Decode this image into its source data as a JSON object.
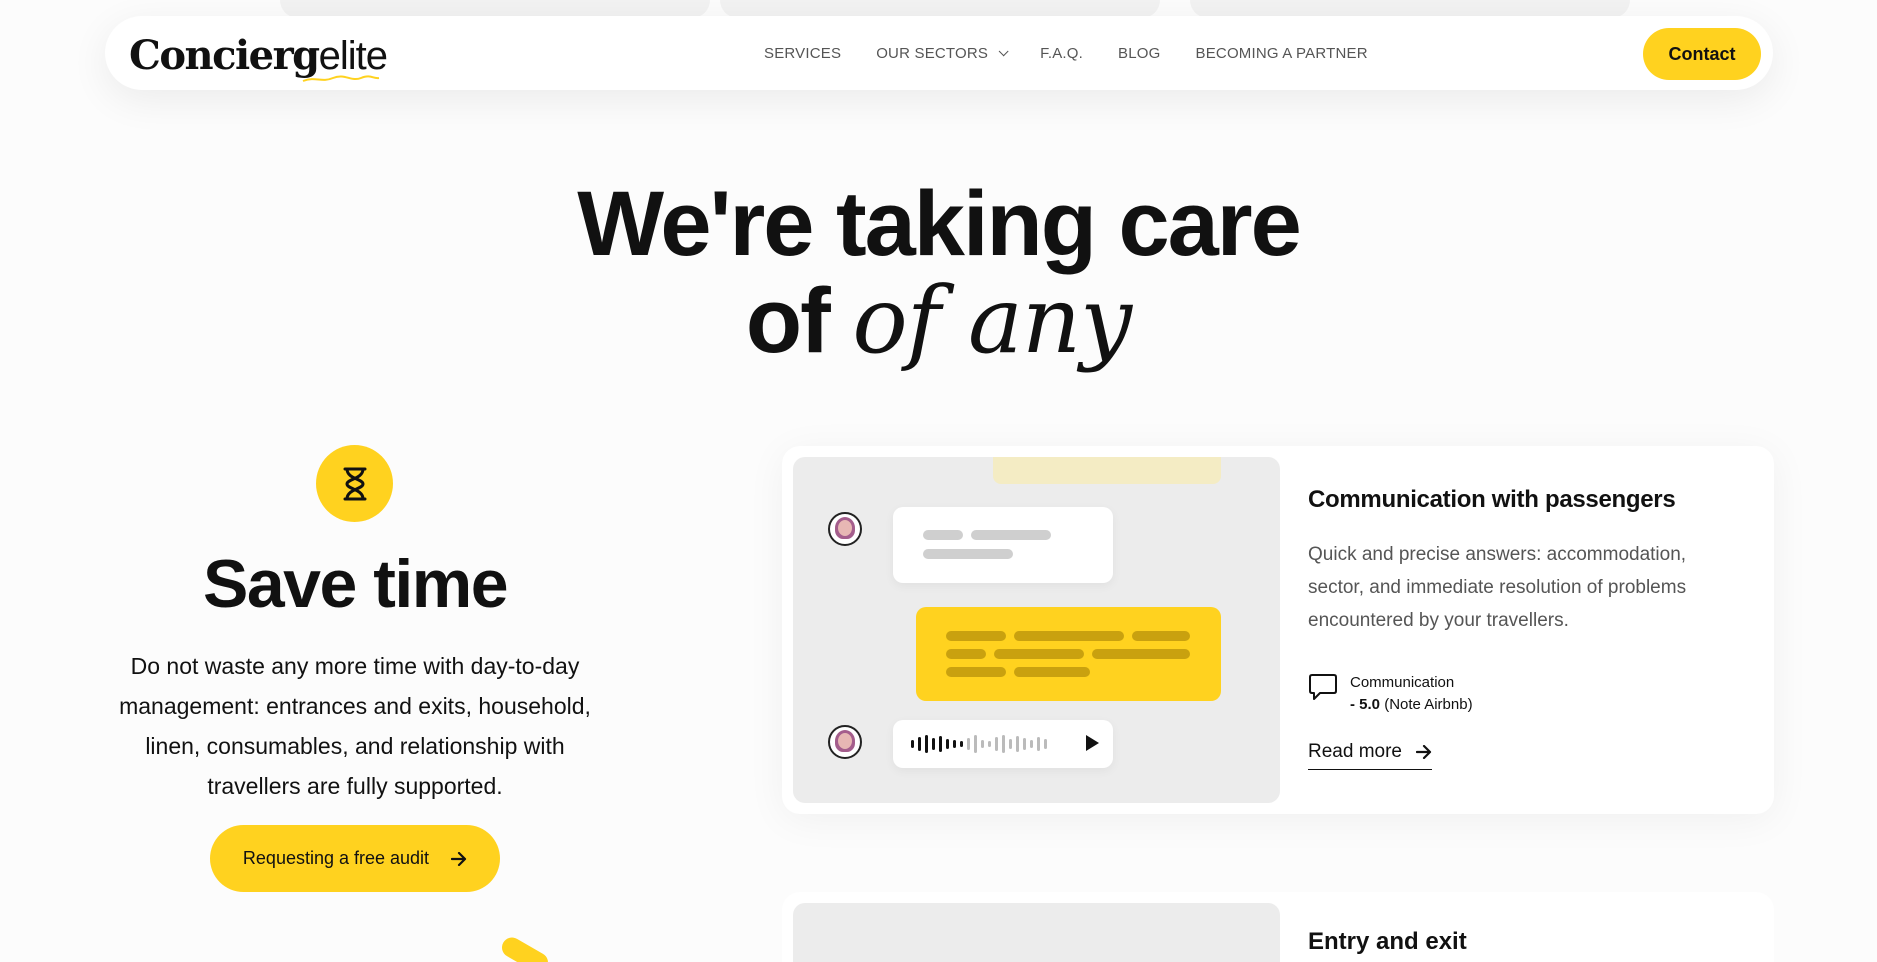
{
  "header": {
    "logo_bold": "Concierg",
    "logo_light": "elite",
    "nav": [
      {
        "label": "SERVICES"
      },
      {
        "label": "OUR SECTORS"
      },
      {
        "label": "F.A.Q."
      },
      {
        "label": "BLOG"
      },
      {
        "label": "BECOMING A PARTNER"
      }
    ],
    "contact_label": "Contact"
  },
  "hero": {
    "line1": "We're taking care",
    "line2_prefix": "of ",
    "line2_italic": "of any"
  },
  "feature": {
    "icon": "hourglass-icon",
    "title": "Save time",
    "description": "Do not waste any more time with day-to-day management: entrances and exits, household, linen, consumables, and relationship with travellers are fully supported.",
    "cta_label": "Requesting a free audit"
  },
  "cards": [
    {
      "title": "Communication with passengers",
      "description": "Quick and precise answers: accommodation, sector, and immediate resolution of problems encountered by your travellers.",
      "rating_label": "Communication",
      "rating_prefix": "- ",
      "rating_value": "5.0",
      "rating_source": " (Note Airbnb)",
      "read_more": "Read more"
    },
    {
      "title": "Entry and exit"
    }
  ],
  "colors": {
    "accent": "#ffd21f",
    "text": "#111111",
    "muted": "#555555",
    "card_visual_bg": "#ececec"
  }
}
